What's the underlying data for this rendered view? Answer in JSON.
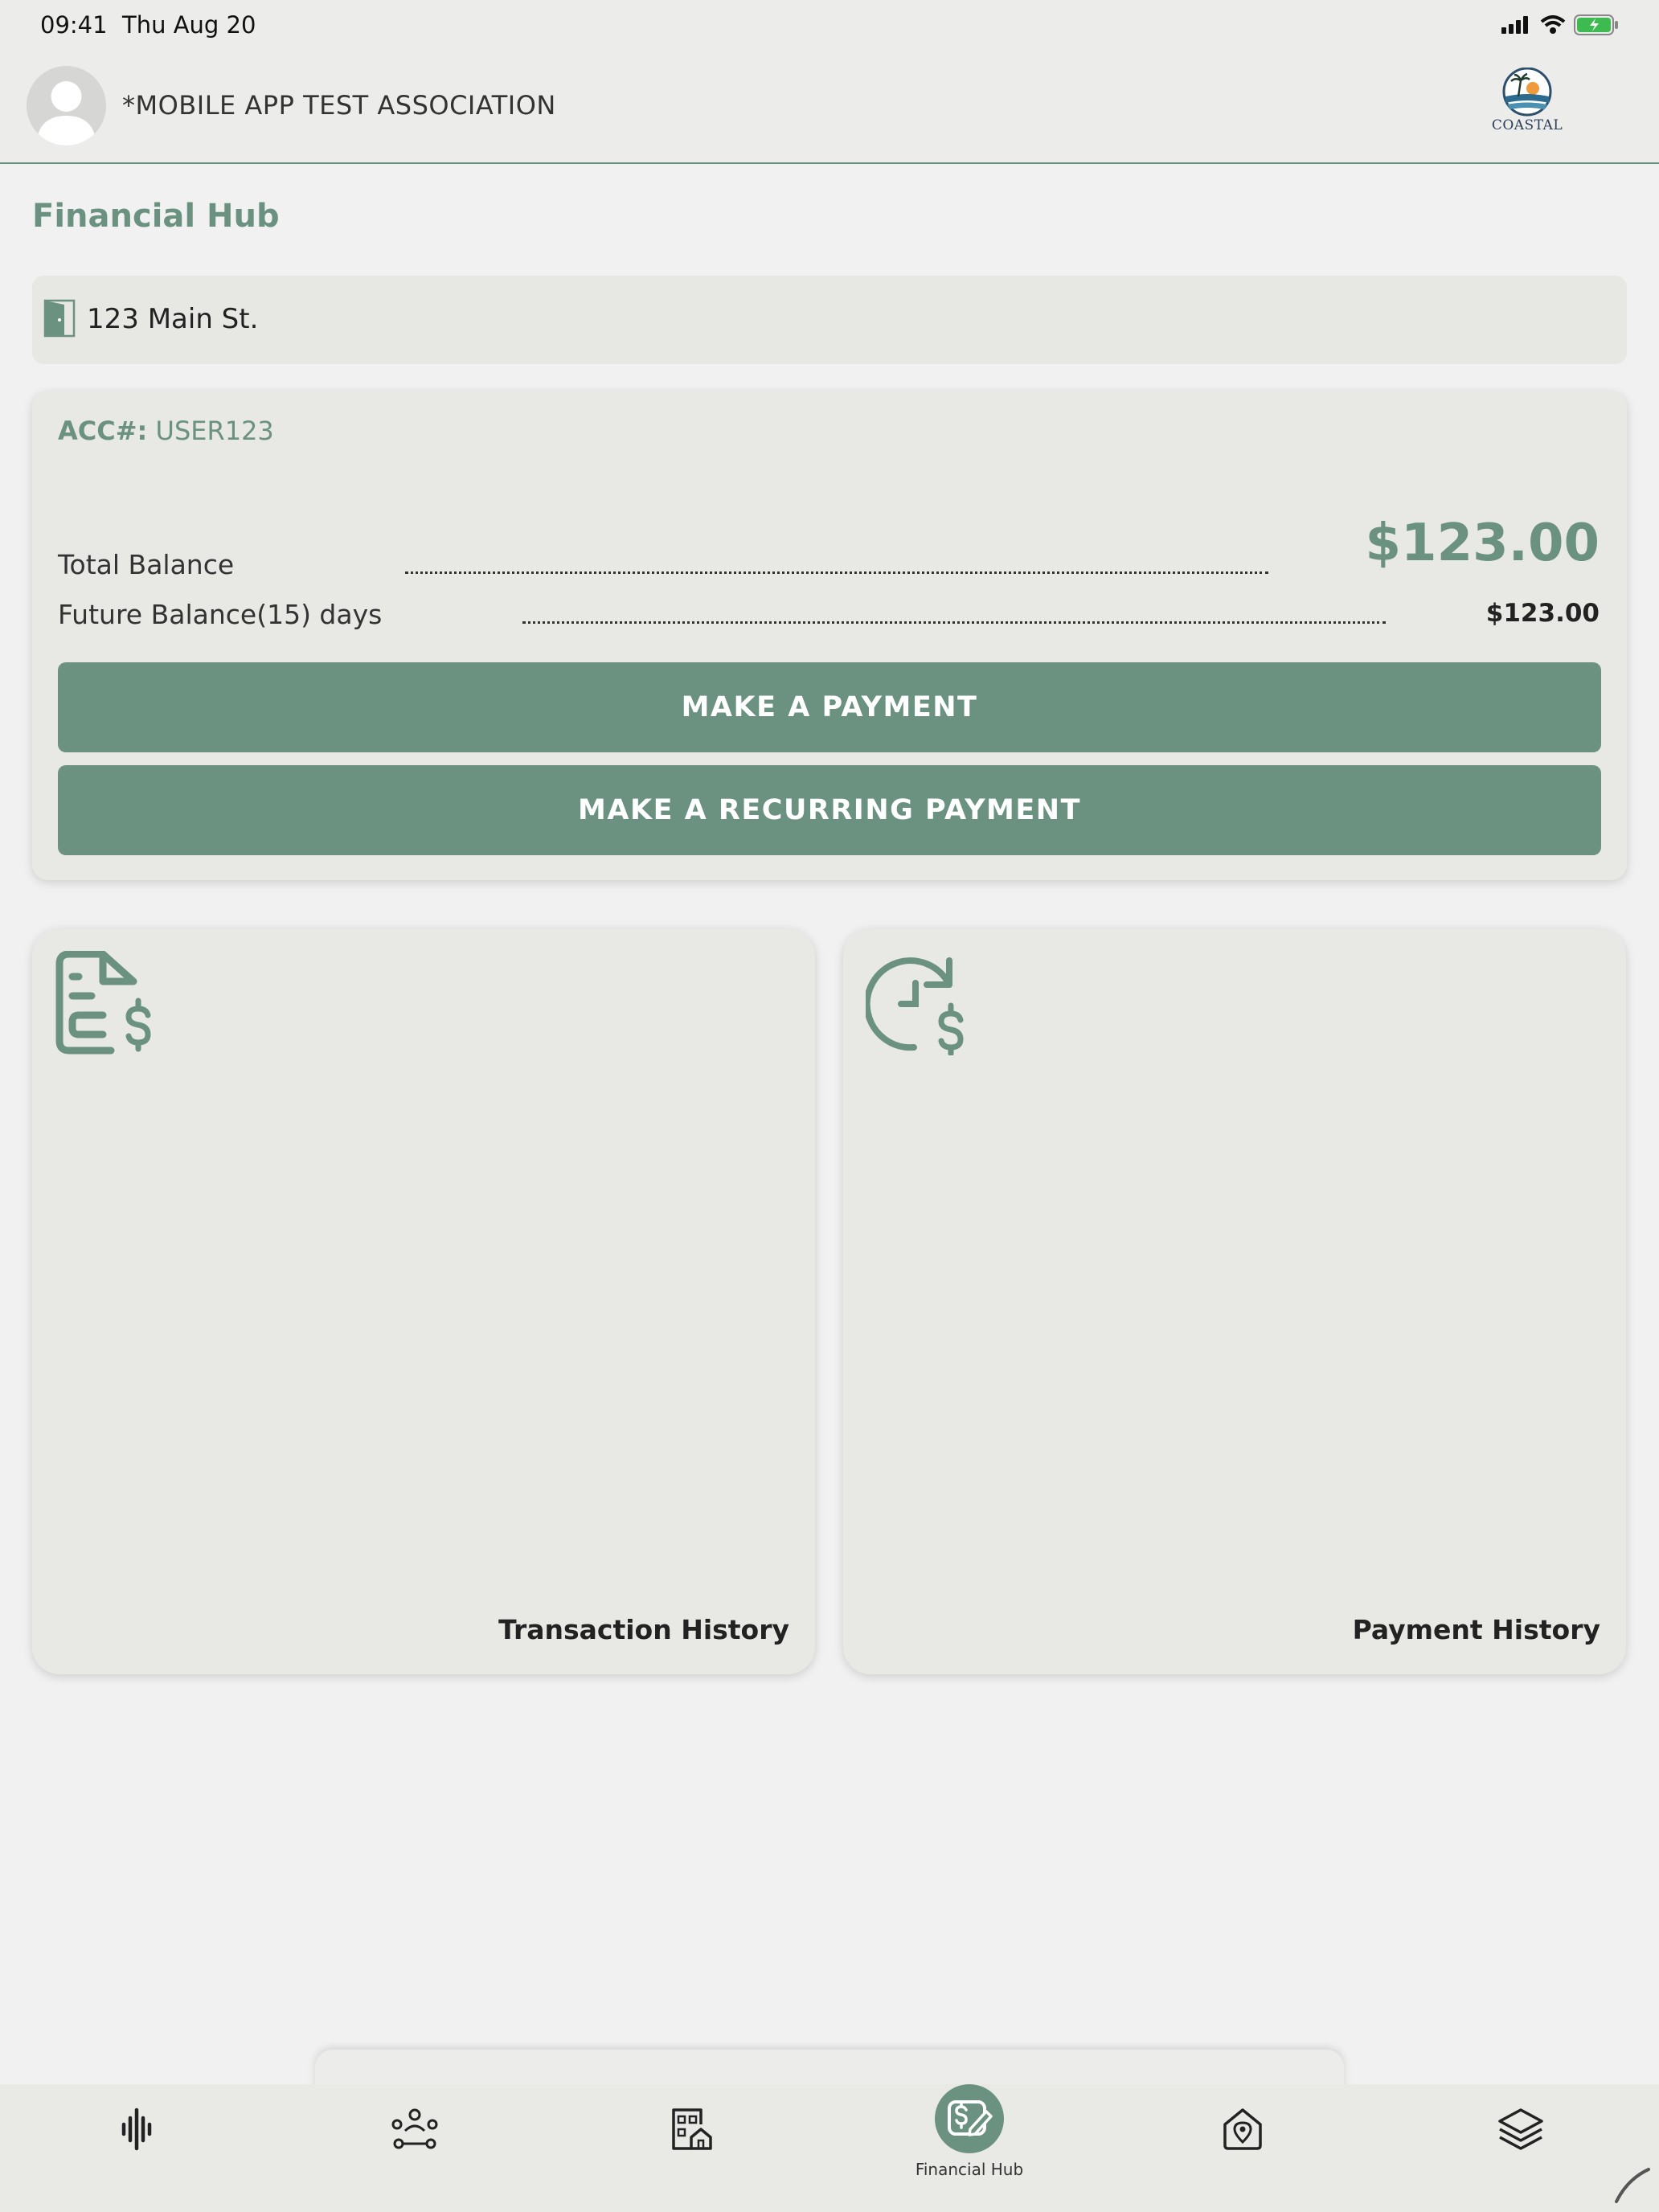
{
  "status_bar": {
    "time": "09:41",
    "date": "Thu Aug 20"
  },
  "header": {
    "association_name": "*MOBILE APP TEST ASSOCIATION",
    "logo_text": "COASTAL"
  },
  "page": {
    "title": "Financial Hub"
  },
  "address": {
    "text": "123 Main St."
  },
  "account": {
    "acc_label": "ACC#:",
    "acc_number": "USER123",
    "total_balance_label": "Total Balance",
    "total_balance_value": "$123.00",
    "future_balance_label": "Future Balance",
    "future_days": "(15) days",
    "future_balance_value": "$123.00",
    "pay_button": "MAKE A PAYMENT",
    "recurring_button": "MAKE A RECURRING PAYMENT"
  },
  "tiles": [
    {
      "label": "Transaction History",
      "icon": "invoice-dollar-icon"
    },
    {
      "label": "Payment History",
      "icon": "clock-dollar-icon"
    }
  ],
  "bottom_nav": {
    "items": [
      {
        "icon": "activity-icon"
      },
      {
        "icon": "community-icon"
      },
      {
        "icon": "building-home-icon"
      },
      {
        "icon": "financial-hub-icon",
        "label": "Financial Hub",
        "active": true
      },
      {
        "icon": "home-location-icon"
      },
      {
        "icon": "layers-icon"
      }
    ]
  },
  "colors": {
    "accent": "#6b9280",
    "background": "#f1f1f1",
    "card": "#e8e8e5"
  }
}
